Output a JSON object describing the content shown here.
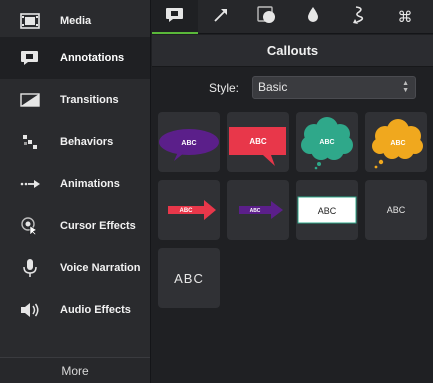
{
  "sidebar": {
    "items": [
      {
        "label": "Media",
        "icon": "film-strip-icon"
      },
      {
        "label": "Annotations",
        "icon": "callout-icon",
        "active": true
      },
      {
        "label": "Transitions",
        "icon": "transition-icon"
      },
      {
        "label": "Behaviors",
        "icon": "behaviors-icon"
      },
      {
        "label": "Animations",
        "icon": "animation-arrow-icon"
      },
      {
        "label": "Cursor Effects",
        "icon": "cursor-effects-icon"
      },
      {
        "label": "Voice Narration",
        "icon": "microphone-icon"
      },
      {
        "label": "Audio Effects",
        "icon": "speaker-icon"
      }
    ],
    "more_label": "More"
  },
  "tabs": [
    {
      "name": "callouts-tab",
      "icon": "callout-icon",
      "active": true
    },
    {
      "name": "arrows-tab",
      "icon": "arrow-icon"
    },
    {
      "name": "shapes-tab",
      "icon": "shape-icon"
    },
    {
      "name": "blur-tab",
      "icon": "drop-icon"
    },
    {
      "name": "sketch-tab",
      "icon": "squiggle-icon"
    },
    {
      "name": "keystroke-tab",
      "icon": "command-key-icon"
    }
  ],
  "panel": {
    "title": "Callouts",
    "style_label": "Style:",
    "style_value": "Basic"
  },
  "callouts": {
    "text": "ABC",
    "colors": {
      "purple": "#5b1f8a",
      "red": "#e8374a",
      "teal": "#2fa88a",
      "orange": "#f0a81e",
      "accent_green": "#5ab83a"
    }
  }
}
